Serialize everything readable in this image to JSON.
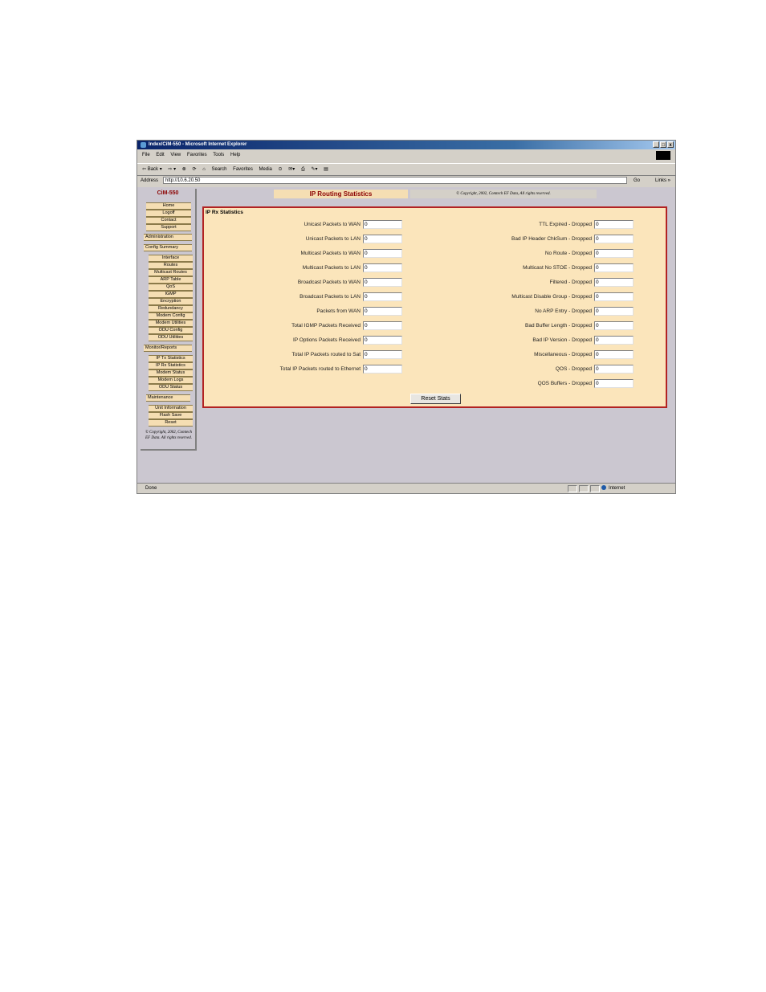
{
  "window": {
    "title": "Index/CiM-550 - Microsoft Internet Explorer",
    "controls": [
      "_",
      "□",
      "x"
    ]
  },
  "menubar": [
    "File",
    "Edit",
    "View",
    "Favorites",
    "Tools",
    "Help"
  ],
  "toolbar": [
    "⇦ Back ▾",
    "⇨ ▾",
    "⊗",
    "⟳",
    "⌂",
    "Search",
    "Favorites",
    "Media",
    "⊙",
    "✉▾",
    "⎙",
    "✎▾",
    "▤"
  ],
  "address": {
    "label": "Address",
    "url": "http://10.6.20.50",
    "go": "Go",
    "links": "Links »"
  },
  "nav": {
    "brand": "CiM-550",
    "top_items": [
      "Home",
      "Logoff",
      "Contact",
      "Support"
    ],
    "admin_header": "Administration",
    "config_header": "Config Summary",
    "config_items": [
      "Interface",
      "Routes",
      "Multicast Routes",
      "ARP Table",
      "QoS",
      "IGMP",
      "Encryption",
      "Redundancy",
      "Modem Config",
      "Modem Utilities",
      "ODU Config",
      "ODU Utilities"
    ],
    "monitor_header": "Monitor/Reports",
    "monitor_items": [
      "IP Tx Statistics",
      "IP Rx Statistics",
      "Modem Status",
      "Modem Logs",
      "ODU Status"
    ],
    "maint_header": "Maintenance",
    "maint_items": [
      "Unit Information",
      "Flash Save",
      "Reset"
    ],
    "copyright": "© Copyright, 2002, Comtech EF Data. All rights reserved."
  },
  "page": {
    "title": "IP Routing Statistics",
    "copyright": "© Copyright, 2002, Comtech EF Data, All rights reserved."
  },
  "panel": {
    "title": "IP Rx Statistics",
    "left": [
      {
        "label": "Unicast Packets to WAN",
        "value": "0"
      },
      {
        "label": "Unicast Packets to LAN",
        "value": "0"
      },
      {
        "label": "Multicast Packets to WAN",
        "value": "0"
      },
      {
        "label": "Multicast Packets to LAN",
        "value": "0"
      },
      {
        "label": "Broadcast Packets to WAN",
        "value": "0"
      },
      {
        "label": "Broadcast Packets to LAN",
        "value": "0"
      },
      {
        "label": "Packets from WAN",
        "value": "0"
      },
      {
        "label": "Total IGMP Packets Received",
        "value": "0"
      },
      {
        "label": "IP Options Packets Received",
        "value": "0"
      },
      {
        "label": "Total IP Packets routed to Sat",
        "value": "0"
      },
      {
        "label": "Total IP Packets routed to Ethernet",
        "value": "0"
      }
    ],
    "right": [
      {
        "label": "TTL Expired - Dropped",
        "value": "0"
      },
      {
        "label": "Bad IP Header ChkSum - Dropped",
        "value": "0"
      },
      {
        "label": "No Route - Dropped",
        "value": "0"
      },
      {
        "label": "Multicast No STOE - Dropped",
        "value": "0"
      },
      {
        "label": "Filtered - Dropped",
        "value": "0"
      },
      {
        "label": "Multicast Disable Group - Dropped",
        "value": "0"
      },
      {
        "label": "No ARP Entry - Dropped",
        "value": "0"
      },
      {
        "label": "Bad Buffer Length - Dropped",
        "value": "0"
      },
      {
        "label": "Bad IP Version - Dropped",
        "value": "0"
      },
      {
        "label": "Miscellaneous - Dropped",
        "value": "0"
      },
      {
        "label": "QOS - Dropped",
        "value": "0"
      },
      {
        "label": "QOS Buffers - Dropped",
        "value": "0"
      }
    ],
    "reset_label": "Reset Stats"
  },
  "status": {
    "text": "Done",
    "zone": "Internet"
  }
}
